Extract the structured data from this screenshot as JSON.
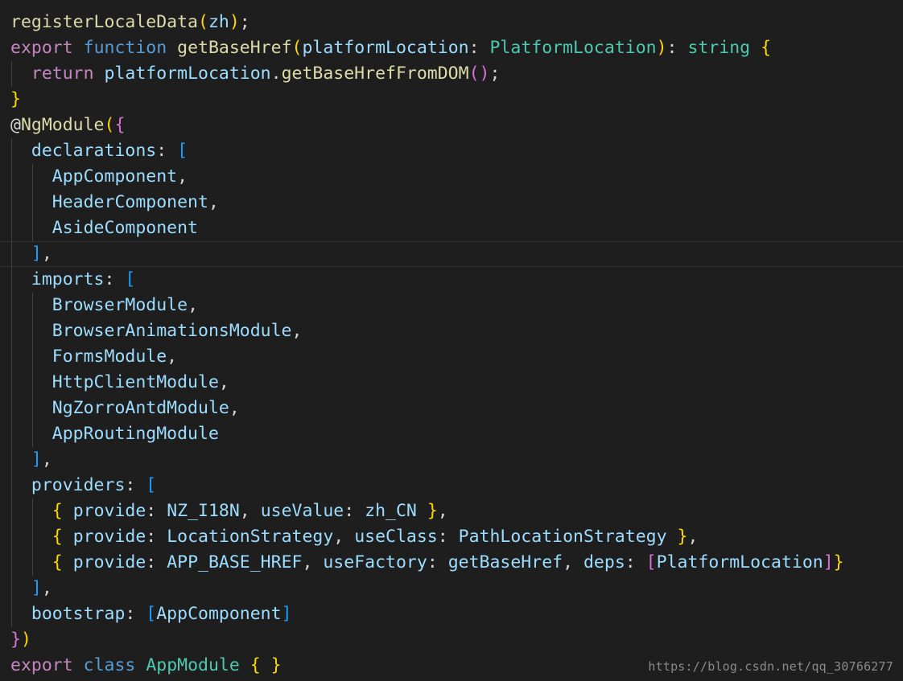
{
  "editor": {
    "lines": [
      {
        "current": false,
        "guides": 0,
        "tokens": [
          {
            "t": "registerLocaleData",
            "c": "f"
          },
          {
            "t": "(",
            "c": "y"
          },
          {
            "t": "zh",
            "c": "v"
          },
          {
            "t": ")",
            "c": "y"
          },
          {
            "t": ";",
            "c": "p"
          }
        ]
      },
      {
        "current": false,
        "guides": 0,
        "tokens": [
          {
            "t": "export",
            "c": "c"
          },
          {
            "t": " ",
            "c": "p"
          },
          {
            "t": "function",
            "c": "k"
          },
          {
            "t": " ",
            "c": "p"
          },
          {
            "t": "getBaseHref",
            "c": "f"
          },
          {
            "t": "(",
            "c": "y"
          },
          {
            "t": "platformLocation",
            "c": "v"
          },
          {
            "t": ": ",
            "c": "p"
          },
          {
            "t": "PlatformLocation",
            "c": "t"
          },
          {
            "t": ")",
            "c": "y"
          },
          {
            "t": ": ",
            "c": "p"
          },
          {
            "t": "string",
            "c": "t"
          },
          {
            "t": " ",
            "c": "p"
          },
          {
            "t": "{",
            "c": "y"
          }
        ]
      },
      {
        "current": false,
        "guides": 1,
        "tokens": [
          {
            "t": "  ",
            "c": "p"
          },
          {
            "t": "return",
            "c": "c"
          },
          {
            "t": " ",
            "c": "p"
          },
          {
            "t": "platformLocation",
            "c": "v"
          },
          {
            "t": ".",
            "c": "p"
          },
          {
            "t": "getBaseHrefFromDOM",
            "c": "f"
          },
          {
            "t": "(",
            "c": "m"
          },
          {
            "t": ")",
            "c": "m"
          },
          {
            "t": ";",
            "c": "p"
          }
        ]
      },
      {
        "current": false,
        "guides": 0,
        "tokens": [
          {
            "t": "}",
            "c": "y"
          }
        ]
      },
      {
        "current": false,
        "guides": 0,
        "tokens": [
          {
            "t": "@",
            "c": "p"
          },
          {
            "t": "NgModule",
            "c": "f"
          },
          {
            "t": "(",
            "c": "y"
          },
          {
            "t": "{",
            "c": "m"
          }
        ]
      },
      {
        "current": false,
        "guides": 1,
        "tokens": [
          {
            "t": "  ",
            "c": "p"
          },
          {
            "t": "declarations",
            "c": "v"
          },
          {
            "t": ": ",
            "c": "p"
          },
          {
            "t": "[",
            "c": "b"
          }
        ]
      },
      {
        "current": false,
        "guides": 2,
        "tokens": [
          {
            "t": "    ",
            "c": "p"
          },
          {
            "t": "AppComponent",
            "c": "v"
          },
          {
            "t": ",",
            "c": "p"
          }
        ]
      },
      {
        "current": false,
        "guides": 2,
        "tokens": [
          {
            "t": "    ",
            "c": "p"
          },
          {
            "t": "HeaderComponent",
            "c": "v"
          },
          {
            "t": ",",
            "c": "p"
          }
        ]
      },
      {
        "current": false,
        "guides": 2,
        "tokens": [
          {
            "t": "    ",
            "c": "p"
          },
          {
            "t": "AsideComponent",
            "c": "v"
          }
        ]
      },
      {
        "current": true,
        "guides": 1,
        "tokens": [
          {
            "t": "  ",
            "c": "p"
          },
          {
            "t": "]",
            "c": "b"
          },
          {
            "t": ",",
            "c": "p"
          }
        ]
      },
      {
        "current": false,
        "guides": 1,
        "tokens": [
          {
            "t": "  ",
            "c": "p"
          },
          {
            "t": "imports",
            "c": "v"
          },
          {
            "t": ": ",
            "c": "p"
          },
          {
            "t": "[",
            "c": "b"
          }
        ]
      },
      {
        "current": false,
        "guides": 2,
        "tokens": [
          {
            "t": "    ",
            "c": "p"
          },
          {
            "t": "BrowserModule",
            "c": "v"
          },
          {
            "t": ",",
            "c": "p"
          }
        ]
      },
      {
        "current": false,
        "guides": 2,
        "tokens": [
          {
            "t": "    ",
            "c": "p"
          },
          {
            "t": "BrowserAnimationsModule",
            "c": "v"
          },
          {
            "t": ",",
            "c": "p"
          }
        ]
      },
      {
        "current": false,
        "guides": 2,
        "tokens": [
          {
            "t": "    ",
            "c": "p"
          },
          {
            "t": "FormsModule",
            "c": "v"
          },
          {
            "t": ",",
            "c": "p"
          }
        ]
      },
      {
        "current": false,
        "guides": 2,
        "tokens": [
          {
            "t": "    ",
            "c": "p"
          },
          {
            "t": "HttpClientModule",
            "c": "v"
          },
          {
            "t": ",",
            "c": "p"
          }
        ]
      },
      {
        "current": false,
        "guides": 2,
        "tokens": [
          {
            "t": "    ",
            "c": "p"
          },
          {
            "t": "NgZorroAntdModule",
            "c": "v"
          },
          {
            "t": ",",
            "c": "p"
          }
        ]
      },
      {
        "current": false,
        "guides": 2,
        "tokens": [
          {
            "t": "    ",
            "c": "p"
          },
          {
            "t": "AppRoutingModule",
            "c": "v"
          }
        ]
      },
      {
        "current": false,
        "guides": 1,
        "tokens": [
          {
            "t": "  ",
            "c": "p"
          },
          {
            "t": "]",
            "c": "b"
          },
          {
            "t": ",",
            "c": "p"
          }
        ]
      },
      {
        "current": false,
        "guides": 1,
        "tokens": [
          {
            "t": "  ",
            "c": "p"
          },
          {
            "t": "providers",
            "c": "v"
          },
          {
            "t": ": ",
            "c": "p"
          },
          {
            "t": "[",
            "c": "b"
          }
        ]
      },
      {
        "current": false,
        "guides": 2,
        "tokens": [
          {
            "t": "    ",
            "c": "p"
          },
          {
            "t": "{",
            "c": "y"
          },
          {
            "t": " ",
            "c": "p"
          },
          {
            "t": "provide",
            "c": "v"
          },
          {
            "t": ": ",
            "c": "p"
          },
          {
            "t": "NZ_I18N",
            "c": "v"
          },
          {
            "t": ", ",
            "c": "p"
          },
          {
            "t": "useValue",
            "c": "v"
          },
          {
            "t": ": ",
            "c": "p"
          },
          {
            "t": "zh_CN",
            "c": "v"
          },
          {
            "t": " ",
            "c": "p"
          },
          {
            "t": "}",
            "c": "y"
          },
          {
            "t": ",",
            "c": "p"
          }
        ]
      },
      {
        "current": false,
        "guides": 2,
        "tokens": [
          {
            "t": "    ",
            "c": "p"
          },
          {
            "t": "{",
            "c": "y"
          },
          {
            "t": " ",
            "c": "p"
          },
          {
            "t": "provide",
            "c": "v"
          },
          {
            "t": ": ",
            "c": "p"
          },
          {
            "t": "LocationStrategy",
            "c": "v"
          },
          {
            "t": ", ",
            "c": "p"
          },
          {
            "t": "useClass",
            "c": "v"
          },
          {
            "t": ": ",
            "c": "p"
          },
          {
            "t": "PathLocationStrategy",
            "c": "v"
          },
          {
            "t": " ",
            "c": "p"
          },
          {
            "t": "}",
            "c": "y"
          },
          {
            "t": ",",
            "c": "p"
          }
        ]
      },
      {
        "current": false,
        "guides": 2,
        "tokens": [
          {
            "t": "    ",
            "c": "p"
          },
          {
            "t": "{",
            "c": "y"
          },
          {
            "t": " ",
            "c": "p"
          },
          {
            "t": "provide",
            "c": "v"
          },
          {
            "t": ": ",
            "c": "p"
          },
          {
            "t": "APP_BASE_HREF",
            "c": "v"
          },
          {
            "t": ", ",
            "c": "p"
          },
          {
            "t": "useFactory",
            "c": "v"
          },
          {
            "t": ": ",
            "c": "p"
          },
          {
            "t": "getBaseHref",
            "c": "v"
          },
          {
            "t": ", ",
            "c": "p"
          },
          {
            "t": "deps",
            "c": "v"
          },
          {
            "t": ": ",
            "c": "p"
          },
          {
            "t": "[",
            "c": "m"
          },
          {
            "t": "PlatformLocation",
            "c": "v"
          },
          {
            "t": "]",
            "c": "m"
          },
          {
            "t": "}",
            "c": "y"
          }
        ]
      },
      {
        "current": false,
        "guides": 1,
        "tokens": [
          {
            "t": "  ",
            "c": "p"
          },
          {
            "t": "]",
            "c": "b"
          },
          {
            "t": ",",
            "c": "p"
          }
        ]
      },
      {
        "current": false,
        "guides": 1,
        "tokens": [
          {
            "t": "  ",
            "c": "p"
          },
          {
            "t": "bootstrap",
            "c": "v"
          },
          {
            "t": ": ",
            "c": "p"
          },
          {
            "t": "[",
            "c": "b"
          },
          {
            "t": "AppComponent",
            "c": "v"
          },
          {
            "t": "]",
            "c": "b"
          }
        ]
      },
      {
        "current": false,
        "guides": 0,
        "tokens": [
          {
            "t": "}",
            "c": "m"
          },
          {
            "t": ")",
            "c": "y"
          }
        ]
      },
      {
        "current": false,
        "guides": 0,
        "tokens": [
          {
            "t": "export",
            "c": "c"
          },
          {
            "t": " ",
            "c": "p"
          },
          {
            "t": "class",
            "c": "k"
          },
          {
            "t": " ",
            "c": "p"
          },
          {
            "t": "AppModule",
            "c": "t"
          },
          {
            "t": " ",
            "c": "p"
          },
          {
            "t": "{",
            "c": "y"
          },
          {
            "t": " ",
            "c": "p"
          },
          {
            "t": "}",
            "c": "y"
          }
        ]
      }
    ]
  },
  "watermark": "https://blog.csdn.net/qq_30766277",
  "colors": {
    "background": "#1e1e1e",
    "keyword_control": "#c586c0",
    "keyword_storage": "#569cd6",
    "function": "#dcdcaa",
    "variable": "#9cdcfe",
    "type": "#4ec9b0",
    "punctuation": "#d4d4d4",
    "bracket_yellow": "#ffd700",
    "bracket_magenta": "#da70d6",
    "bracket_blue": "#179fff"
  }
}
